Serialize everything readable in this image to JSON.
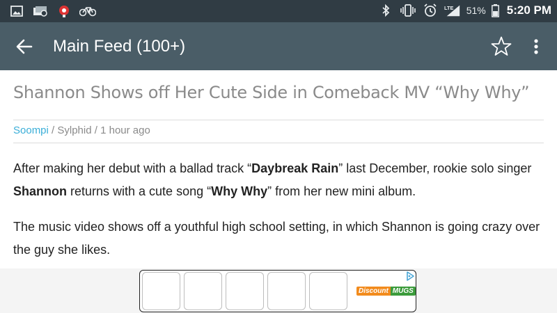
{
  "status_bar": {
    "icons_left": [
      "image-icon",
      "cast-icon",
      "app-icon",
      "bicycle-icon"
    ],
    "icons_right": [
      "bluetooth-icon",
      "vibrate-icon",
      "alarm-icon",
      "lte-signal-icon"
    ],
    "battery_percent": "51%",
    "time": "5:20 PM"
  },
  "app_bar": {
    "title": "Main Feed (100+)",
    "back_icon": "arrow-left-icon",
    "star_icon": "star-outline-icon",
    "more_icon": "more-vertical-icon"
  },
  "article": {
    "title": "Shannon Shows off Her Cute Side in Comeback MV “Why Why”",
    "source": "Soompi",
    "sep1": " / ",
    "category": "Sylphid",
    "sep2": " / ",
    "time": "1 hour ago",
    "para1": {
      "t1": "After making her debut with a ballad track “",
      "b1": "Daybreak Rain",
      "t2": "” last December, rookie solo singer ",
      "b2": "Shannon",
      "t3": " returns with a cute song “",
      "b3": "Why Why",
      "t4": "” from her new mini album."
    },
    "para2": "The music video shows off a youthful high school setting, in which Shannon is going crazy over the guy she likes."
  },
  "ad": {
    "logo_part1": "Discount",
    "logo_part2": "MUGS",
    "tile_count": 5,
    "colors": {
      "discount": "#f28b1d",
      "mugs": "#3b9b3b"
    }
  },
  "colors": {
    "status_bar": "#303c44",
    "app_bar": "#4a5d67",
    "source_link": "#3aaed8",
    "title_text": "#8a8a8a"
  }
}
